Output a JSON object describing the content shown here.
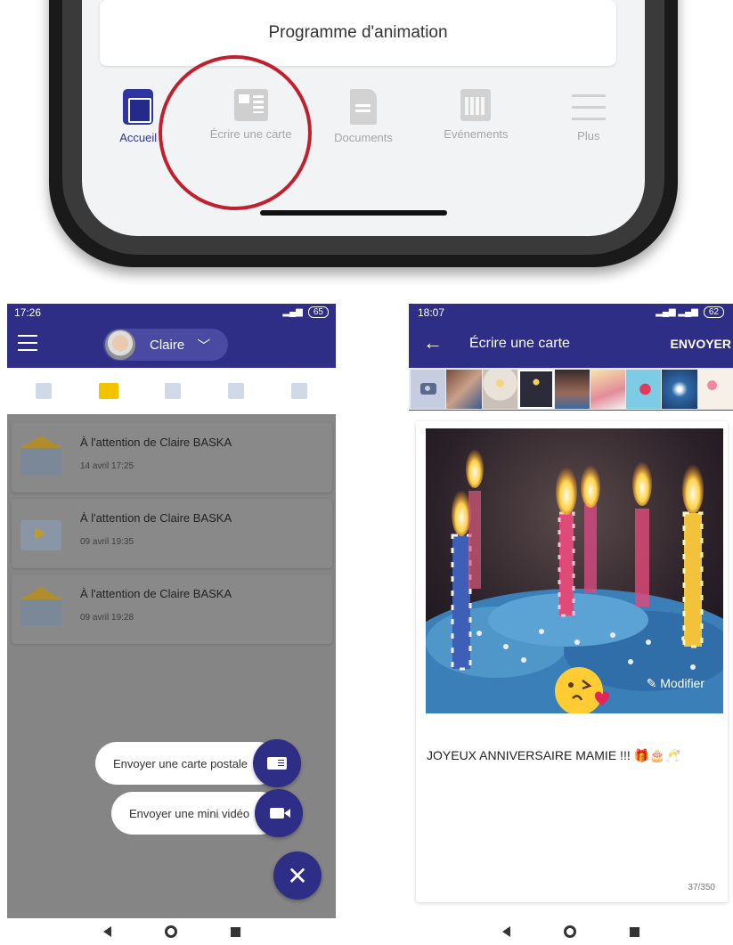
{
  "top_phone": {
    "card_title": "Programme d'animation",
    "tabs": [
      {
        "label": "Accueil",
        "icon": "home-icon"
      },
      {
        "label": "Écrire une carte",
        "icon": "card-icon"
      },
      {
        "label": "Documents",
        "icon": "document-icon"
      },
      {
        "label": "Evénements",
        "icon": "calendar-icon"
      },
      {
        "label": "Plus",
        "icon": "menu-icon"
      }
    ],
    "highlight_color": "#c0202e"
  },
  "left_screen": {
    "status": {
      "time": "17:26",
      "battery": "65"
    },
    "user": {
      "name": "Claire"
    },
    "messages": [
      {
        "title": "À l'attention de Claire BASKA",
        "date": "14 avril 17:25",
        "type": "letter"
      },
      {
        "title": "À l'attention de Claire BASKA",
        "date": "09 avril 19:35",
        "type": "video"
      },
      {
        "title": "À l'attention de Claire BASKA",
        "date": "09 avril 19:28",
        "type": "letter"
      }
    ],
    "actions": {
      "postcard": "Envoyer une carte postale",
      "video": "Envoyer une mini vidéo"
    }
  },
  "right_screen": {
    "status": {
      "time": "18:07",
      "battery": "62"
    },
    "title": "Écrire une carte",
    "send": "ENVOYER",
    "modify": "Modifier",
    "message": "JOYEUX ANNIVERSAIRE MAMIE !!! 🎁🎂🥂",
    "counter": "37/350"
  },
  "colors": {
    "primary": "#2e2e86",
    "accent_yellow": "#f2c400"
  }
}
